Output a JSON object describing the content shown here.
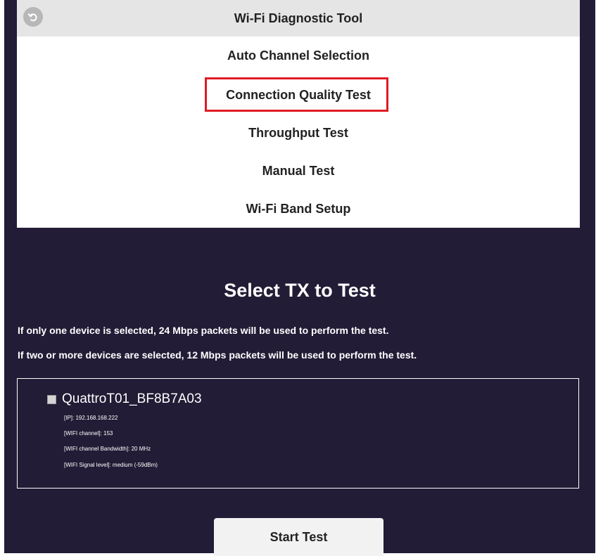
{
  "menu": {
    "title": "Wi-Fi Diagnostic Tool",
    "back_icon": "back-arrow-icon",
    "items": [
      {
        "label": "Auto Channel Selection"
      },
      {
        "label": "Connection Quality Test",
        "highlighted": true
      },
      {
        "label": "Throughput Test"
      },
      {
        "label": "Manual Test"
      },
      {
        "label": "Wi-Fi Band Setup"
      }
    ]
  },
  "select_tx": {
    "title": "Select TX to Test",
    "info_lines": [
      "If only one device is selected, 24 Mbps packets will be used to perform the test.",
      "If two or more devices are selected, 12 Mbps packets will be used to perform the test."
    ]
  },
  "devices": [
    {
      "name": "QuattroT01_BF8B7A03",
      "checked": false,
      "details": [
        "[IP]: 192.168.168.222",
        "[WIFI channel]: 153",
        "[WIFI channel Bandwidth]: 20 MHz",
        "[WIFI Signal level]: medium (-59dBm)"
      ]
    }
  ],
  "start_button": {
    "label": "Start Test"
  },
  "colors": {
    "background": "#221c36",
    "menu_background": "#ffffff",
    "header_background": "#e5e5e5",
    "highlight_border": "#e01b24",
    "text_dark": "#222222",
    "text_light": "#ffffff",
    "button_background": "#f2f2f2"
  }
}
